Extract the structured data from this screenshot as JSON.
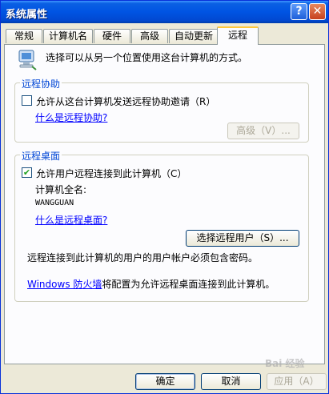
{
  "window": {
    "title": "系统属性",
    "help_icon": "?",
    "close_icon": "✕"
  },
  "tabs": [
    "常规",
    "计算机名",
    "硬件",
    "高级",
    "自动更新",
    "远程"
  ],
  "active_tab": "远程",
  "intro_text": "选择可以从另一个位置使用这台计算机的方式。",
  "remote_assistance": {
    "legend": "远程协助",
    "checkbox_label": "允许从这台计算机发送远程协助邀请（R）",
    "checked": false,
    "help_link": "什么是远程协助?",
    "advanced_button": "高级（V）..."
  },
  "remote_desktop": {
    "legend": "远程桌面",
    "checkbox_label": "允许用户远程连接到此计算机（C）",
    "checked": true,
    "computer_name_label": "计算机全名:",
    "computer_name": "WANGGUAN",
    "help_link": "什么是远程桌面?",
    "select_users_button": "选择远程用户（S）...",
    "password_note": "远程连接到此计算机的用户的用户帐户必须包含密码。",
    "firewall_link": "Windows 防火墙",
    "firewall_text": "将配置为允许远程桌面连接到此计算机。"
  },
  "buttons": {
    "ok": "确定",
    "cancel": "取消",
    "apply": "应用（A）"
  },
  "watermark": "Bai 经验"
}
